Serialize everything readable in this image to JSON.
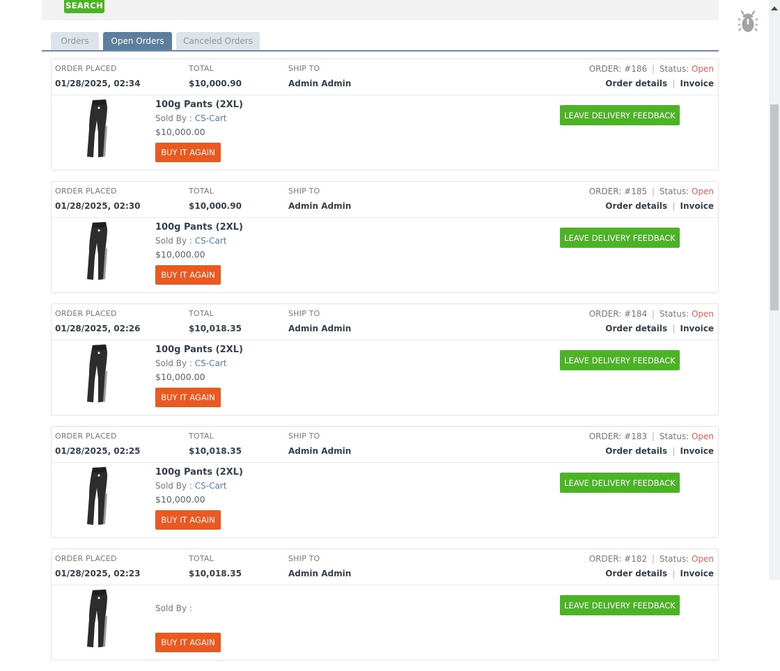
{
  "search": {
    "button_label": "SEARCH"
  },
  "tabs": [
    {
      "label": "Orders"
    },
    {
      "label": "Open Orders"
    },
    {
      "label": "Canceled Orders"
    }
  ],
  "active_tab": "Open Orders",
  "labels": {
    "order_placed": "ORDER PLACED",
    "total": "TOTAL",
    "ship_to": "SHIP TO",
    "order_prefix": "ORDER:",
    "status_prefix": "Status:",
    "pipe": "|",
    "order_details": "Order details",
    "invoice": "Invoice",
    "sold_by": "Sold By :",
    "buy_it_again": "BUY IT AGAIN",
    "leave_feedback": "LEAVE DELIVERY FEEDBACK"
  },
  "orders": [
    {
      "number": "#186",
      "status": "Open",
      "placed": "01/28/2025, 02:34",
      "total": "$10,000.90",
      "ship_to": "Admin Admin",
      "product": {
        "name": "100g Pants (2XL)",
        "sold_by": "CS-Cart",
        "price": "$10,000.00"
      }
    },
    {
      "number": "#185",
      "status": "Open",
      "placed": "01/28/2025, 02:30",
      "total": "$10,000.90",
      "ship_to": "Admin Admin",
      "product": {
        "name": "100g Pants (2XL)",
        "sold_by": "CS-Cart",
        "price": "$10,000.00"
      }
    },
    {
      "number": "#184",
      "status": "Open",
      "placed": "01/28/2025, 02:26",
      "total": "$10,018.35",
      "ship_to": "Admin Admin",
      "product": {
        "name": "100g Pants (2XL)",
        "sold_by": "CS-Cart",
        "price": "$10,000.00"
      }
    },
    {
      "number": "#183",
      "status": "Open",
      "placed": "01/28/2025, 02:25",
      "total": "$10,018.35",
      "ship_to": "Admin Admin",
      "product": {
        "name": "100g Pants (2XL)",
        "sold_by": "CS-Cart",
        "price": "$10,000.00"
      }
    },
    {
      "number": "#182",
      "status": "Open",
      "placed": "01/28/2025, 02:23",
      "total": "$10,018.35",
      "ship_to": "Admin Admin",
      "product": null
    }
  ],
  "icons": {
    "bug_icon": "bug",
    "scroll_up_icon": "triangle-up"
  },
  "colors": {
    "button_green": "#4cb327",
    "button_orange": "#ea5a20",
    "tab_active": "#5e7e9d",
    "status_open": "#e35c4f",
    "text_dark": "#33404d",
    "label_gray": "#70787e",
    "link_blue": "#4f7ea5"
  }
}
